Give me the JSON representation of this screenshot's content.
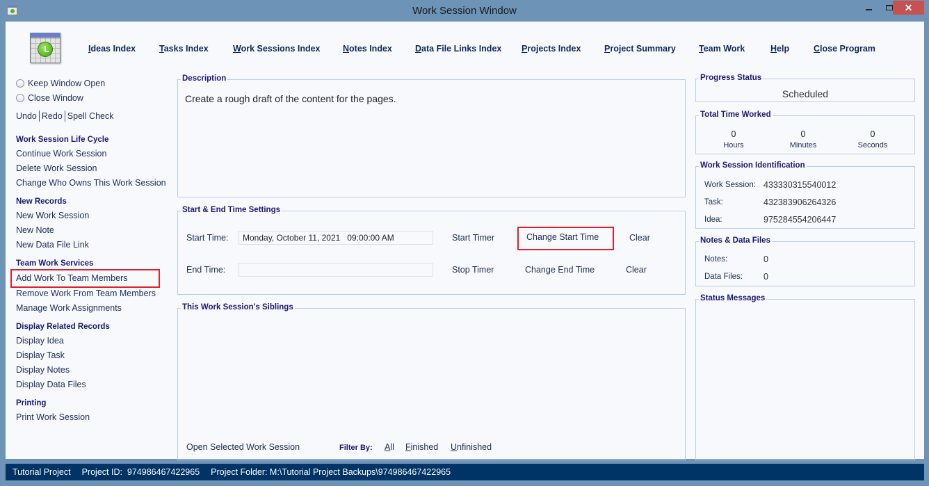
{
  "window": {
    "title": "Work Session Window",
    "close_glyph": "✕"
  },
  "nav": {
    "items": [
      {
        "label": "Ideas Index"
      },
      {
        "label": "Tasks Index"
      },
      {
        "label": "Work Sessions Index"
      },
      {
        "label": "Notes Index"
      },
      {
        "label": "Data File Links Index"
      },
      {
        "label": "Projects Index"
      },
      {
        "label": "Project Summary"
      },
      {
        "label": "Team Work"
      },
      {
        "label": "Help"
      },
      {
        "label": "Close Program"
      }
    ]
  },
  "sidebar": {
    "radios": [
      {
        "label": "Keep Window Open"
      },
      {
        "label": "Close Window"
      }
    ],
    "edit": {
      "undo": "Undo",
      "redo": "Redo",
      "spell": "Spell Check"
    },
    "sections": [
      {
        "title": "Work Session Life Cycle",
        "items": [
          "Continue Work Session",
          "Delete Work Session",
          "Change Who Owns This Work Session"
        ]
      },
      {
        "title": "New Records",
        "items": [
          "New Work Session",
          "New Note",
          "New Data File Link"
        ]
      },
      {
        "title": "Team Work Services",
        "items": [
          "Add Work To Team Members",
          "Remove Work From Team Members",
          "Manage Work Assignments"
        ]
      },
      {
        "title": "Display Related Records",
        "items": [
          "Display Idea",
          "Display Task",
          "Display Notes",
          "Display Data Files"
        ]
      },
      {
        "title": "Printing",
        "items": [
          "Print Work Session"
        ]
      }
    ]
  },
  "description": {
    "title": "Description",
    "text": "Create a rough draft of the content for the pages."
  },
  "times": {
    "title": "Start & End Time Settings",
    "start_label": "Start Time:",
    "start_value": "Monday, October 11, 2021   09:00:00 AM",
    "end_label": "End Time:",
    "end_value": "",
    "start_timer": "Start Timer",
    "change_start": "Change Start Time",
    "clear_start": "Clear",
    "stop_timer": "Stop Timer",
    "change_end": "Change End Time",
    "clear_end": "Clear"
  },
  "siblings": {
    "title": "This Work Session's Siblings",
    "open_selected": "Open Selected Work Session",
    "filter_label": "Filter By:",
    "filter_all": "All",
    "filter_finished": "Finished",
    "filter_unfinished": "Unfinished"
  },
  "progress": {
    "title": "Progress Status",
    "value": "Scheduled"
  },
  "time_worked": {
    "title": "Total Time Worked",
    "hours": "0",
    "hours_label": "Hours",
    "minutes": "0",
    "minutes_label": "Minutes",
    "seconds": "0",
    "seconds_label": "Seconds"
  },
  "identification": {
    "title": "Work Session Identification",
    "work_session_label": "Work Session:",
    "work_session": "433330315540012",
    "task_label": "Task:",
    "task": "432383906264326",
    "idea_label": "Idea:",
    "idea": "975284554206447"
  },
  "notes_files": {
    "title": "Notes & Data Files",
    "notes_label": "Notes:",
    "notes": "0",
    "files_label": "Data Files:",
    "files": "0"
  },
  "status_messages": {
    "title": "Status Messages"
  },
  "statusbar": {
    "project": "Tutorial Project",
    "project_id": "Project ID:  974986467422965",
    "project_folder": "Project Folder: M:\\Tutorial Project Backups\\974986467422965"
  },
  "colors": {
    "frame": "#6d93b6",
    "statusbar": "#003366",
    "highlight_box": "#e0202c",
    "heading": "#1a1a6e"
  }
}
